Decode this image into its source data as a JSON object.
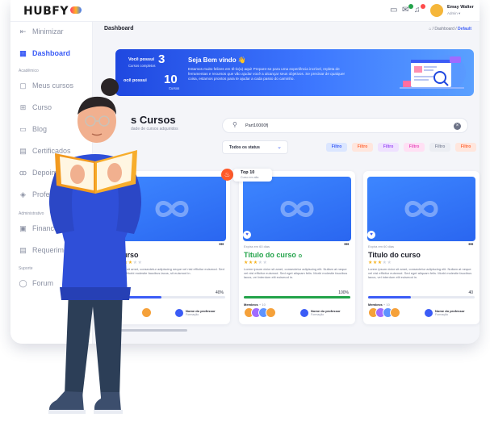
{
  "brand": {
    "logo_text": "HUBFY"
  },
  "user": {
    "name": "Emay Walter",
    "role": "Admin"
  },
  "sidebar": {
    "toggle_label": "Minimizar",
    "items": [
      {
        "label": "Dashboard",
        "icon": "grid-icon"
      },
      {
        "label": "Meus cursos",
        "icon": "book-icon"
      },
      {
        "label": "Curso",
        "icon": "apps-icon"
      },
      {
        "label": "Blog",
        "icon": "monitor-icon"
      },
      {
        "label": "Certificados",
        "icon": "certificate-icon"
      },
      {
        "label": "Depoimentos",
        "icon": "users-icon"
      },
      {
        "label": "Professores",
        "icon": "graduation-icon"
      },
      {
        "label": "Financeiro",
        "icon": "wallet-icon"
      },
      {
        "label": "Requerimentos",
        "icon": "document-icon"
      },
      {
        "label": "Forum",
        "icon": "chat-icon"
      }
    ],
    "sections": {
      "academic": "Acadêmico",
      "admin": "Administrativo",
      "support": "Suporte"
    }
  },
  "header": {
    "page_title": "Dashboard",
    "breadcrumb": {
      "sep1": "/",
      "middle": "Dashboard",
      "sep2": "/",
      "current": "Default"
    }
  },
  "banner": {
    "stat1_label": "Você possui",
    "stat1_value": "3",
    "stat1_sub": "Cursos completos",
    "stat2_label": "ocê possui",
    "stat2_value": "10",
    "stat2_sub": "Cursos",
    "welcome": "Seja Bem vindo",
    "welcome_emoji": "👋",
    "description": "Estamos muito felizes em tê-lo(a) aqui! Prepare-se para uma experiência incrível, repleta de ferramentas e recursos que vão ajudar você a alcançar seus objetivos. Se precisar de qualquer coisa, estamos prontos para te ajudar a cada passo do caminho."
  },
  "courses_section": {
    "title": "s Cursos",
    "subtitle": "dade de cursos adquiridos"
  },
  "search": {
    "value": "Part10000f|"
  },
  "status_filter": {
    "value": "Todos os status"
  },
  "filters": [
    {
      "label": "Filtro",
      "bg": "#dbe6ff",
      "fg": "#3b5cf6"
    },
    {
      "label": "Filtro",
      "bg": "#ffe6dd",
      "fg": "#ff6a3a"
    },
    {
      "label": "Filtro",
      "bg": "#efe1ff",
      "fg": "#9b4ef5"
    },
    {
      "label": "Filtro",
      "bg": "#ffe0f4",
      "fg": "#e64bbd"
    },
    {
      "label": "Filtro",
      "bg": "#eceef3",
      "fg": "#8a90a2"
    },
    {
      "label": "Filtro",
      "bg": "#ffe6dd",
      "fg": "#ff6a3a"
    }
  ],
  "badge": {
    "title": "Top 10",
    "subtitle": "Curso em alta"
  },
  "cards": [
    {
      "expires": "",
      "title": "curso",
      "rating": 3,
      "description": "dolor sit amet, consectetur adipiscing neque vel nisl efficitur euismod. Sed felis. Morbi molestie faucibus lacus, sit euismod in.",
      "progress_text": "40%",
      "progress": 40,
      "bar_color": "#3b5cf6",
      "members_label": "",
      "members_count": "",
      "prof_name": "Nome do professor",
      "prof_area": "Formação"
    },
    {
      "expires": "Expira em 60 dias",
      "title": "Titulo do curso",
      "rating": 3,
      "description": "Lorem ipsum dolor sit amet, consectetur adipiscing elit. Nullam at neque vel nisl efficitur euismod. Sed eget aliquam felis. Morbi molestie faucibus lacus, vel interdum elit euismod in.",
      "progress_text": "100%",
      "progress": 100,
      "bar_color": "#23a34a",
      "members_label": "Membros",
      "members_count": "+ 10",
      "prof_name": "Nome do professor",
      "prof_area": "Formação"
    },
    {
      "expires": "Expira em 60 dias",
      "title": "Titulo do curso",
      "rating": 3,
      "description": "Lorem ipsum dolor sit amet, consectetur adipiscing elit. Nullam at neque vel nisl efficitur euismod. Sed eget aliquam felis. Morbi molestie faucibus lacus, vel interdum elit euismod in.",
      "progress_text": "40",
      "progress": 40,
      "bar_color": "#3b5cf6",
      "members_label": "Membros",
      "members_count": "+ 10",
      "prof_name": "Nome do professor",
      "prof_area": "Formação"
    }
  ],
  "colors": {
    "accent": "#3b5cf6",
    "success": "#23a34a",
    "banner": "#2d5cf0"
  },
  "icons": {
    "more": "more-icon",
    "clear": "clear-icon",
    "search": "search-icon"
  }
}
